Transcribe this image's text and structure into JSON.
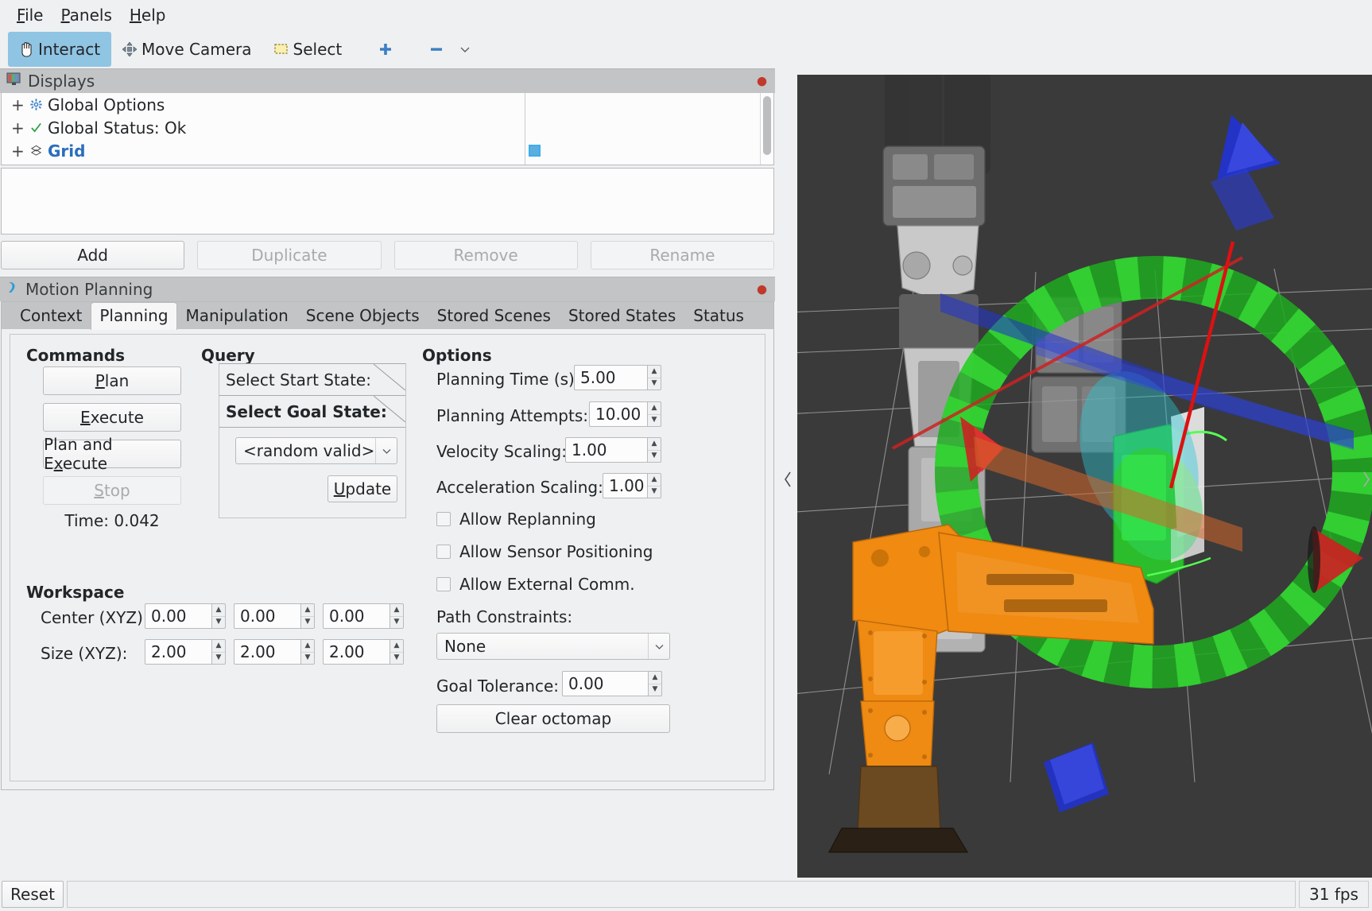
{
  "menu": {
    "items": [
      {
        "label": "File",
        "accel": "F"
      },
      {
        "label": "Panels",
        "accel": "P"
      },
      {
        "label": "Help",
        "accel": "H"
      }
    ]
  },
  "toolbar": {
    "interact": "Interact",
    "move_camera": "Move Camera",
    "select": "Select",
    "interact_icon": "hand-cursor-icon",
    "move_camera_icon": "move-arrows-icon",
    "select_icon": "selection-rect-icon",
    "add_tool_icon": "plus-icon",
    "remove_tool_icon": "minus-icon",
    "more_tools_icon": "chevron-down-icon"
  },
  "displays_panel": {
    "title": "Displays",
    "title_icon": "display-monitor-icon",
    "close_icon": "close-icon",
    "rows": [
      {
        "expander": "+",
        "icon": "gear-icon",
        "label": "Global Options",
        "kind": "options",
        "value": ""
      },
      {
        "expander": "+",
        "icon": "check-icon",
        "label": "Global Status: Ok",
        "kind": "status",
        "value": ""
      },
      {
        "expander": "+",
        "icon": "grid-icon",
        "label": "Grid",
        "kind": "display",
        "value": "color-swatch"
      }
    ],
    "buttons": {
      "add": "Add",
      "duplicate": "Duplicate",
      "remove": "Remove",
      "rename": "Rename"
    },
    "buttons_enabled": {
      "add": true,
      "duplicate": false,
      "remove": false,
      "rename": false
    }
  },
  "motion_planning": {
    "title": "Motion Planning",
    "title_icon": "motion-planning-icon",
    "close_icon": "close-icon",
    "tabs": [
      {
        "label": "Context",
        "selected": false
      },
      {
        "label": "Planning",
        "selected": true
      },
      {
        "label": "Manipulation",
        "selected": false
      },
      {
        "label": "Scene Objects",
        "selected": false
      },
      {
        "label": "Stored Scenes",
        "selected": false
      },
      {
        "label": "Stored States",
        "selected": false
      },
      {
        "label": "Status",
        "selected": false
      }
    ],
    "commands": {
      "heading": "Commands",
      "plan": "Plan",
      "plan_accel": "P",
      "execute": "Execute",
      "execute_accel": "E",
      "plan_and_execute": "Plan and Execute",
      "plan_and_execute_accel": "x",
      "stop": "Stop",
      "stop_accel": "S",
      "stop_enabled": false,
      "time_label": "Time: 0.042"
    },
    "query": {
      "heading": "Query",
      "start_state_label": "Select Start State:",
      "goal_state_label": "Select Goal State:",
      "goal_state_value": "<random valid>",
      "goal_state_options": [
        "<random valid>"
      ],
      "update": "Update",
      "update_accel": "U"
    },
    "options": {
      "heading": "Options",
      "planning_time_label": "Planning Time (s):",
      "planning_time_value": "5.00",
      "planning_attempts_label": "Planning Attempts:",
      "planning_attempts_value": "10.00",
      "velocity_scaling_label": "Velocity Scaling:",
      "velocity_scaling_value": "1.00",
      "acceleration_scaling_label": "Acceleration Scaling:",
      "acceleration_scaling_value": "1.00",
      "allow_replanning": "Allow Replanning",
      "allow_replanning_checked": false,
      "allow_sensor_positioning": "Allow Sensor Positioning",
      "allow_sensor_positioning_checked": false,
      "allow_external_comm": "Allow External Comm.",
      "allow_external_comm_checked": false,
      "path_constraints_label": "Path Constraints:",
      "path_constraints_value": "None",
      "goal_tolerance_label": "Goal Tolerance:",
      "goal_tolerance_value": "0.00",
      "clear_octomap": "Clear octomap"
    },
    "workspace": {
      "heading": "Workspace",
      "center_label": "Center (XYZ):",
      "center_values": [
        "0.00",
        "0.00",
        "0.00"
      ],
      "size_label": "Size (XYZ):",
      "size_values": [
        "2.00",
        "2.00",
        "2.00"
      ]
    }
  },
  "viewport": {
    "background_color": "#3a3a3a",
    "grid_color": "#bdbdbd",
    "robot_current_color": "#f08a10",
    "robot_ghost_color": "#b8b8b8",
    "goal_state_color": "#24e026",
    "marker_ring_color": "#1e9e1e",
    "axis_x_color": "#cc2222",
    "axis_y_color": "#1fbf3a",
    "axis_z_color": "#2233cc",
    "base_color": "#6b4a22",
    "collapse_left_icon": "chevron-left-icon",
    "collapse_right_icon": "chevron-right-icon"
  },
  "statusbar": {
    "reset": "Reset",
    "message": "",
    "fps": "31 fps"
  }
}
